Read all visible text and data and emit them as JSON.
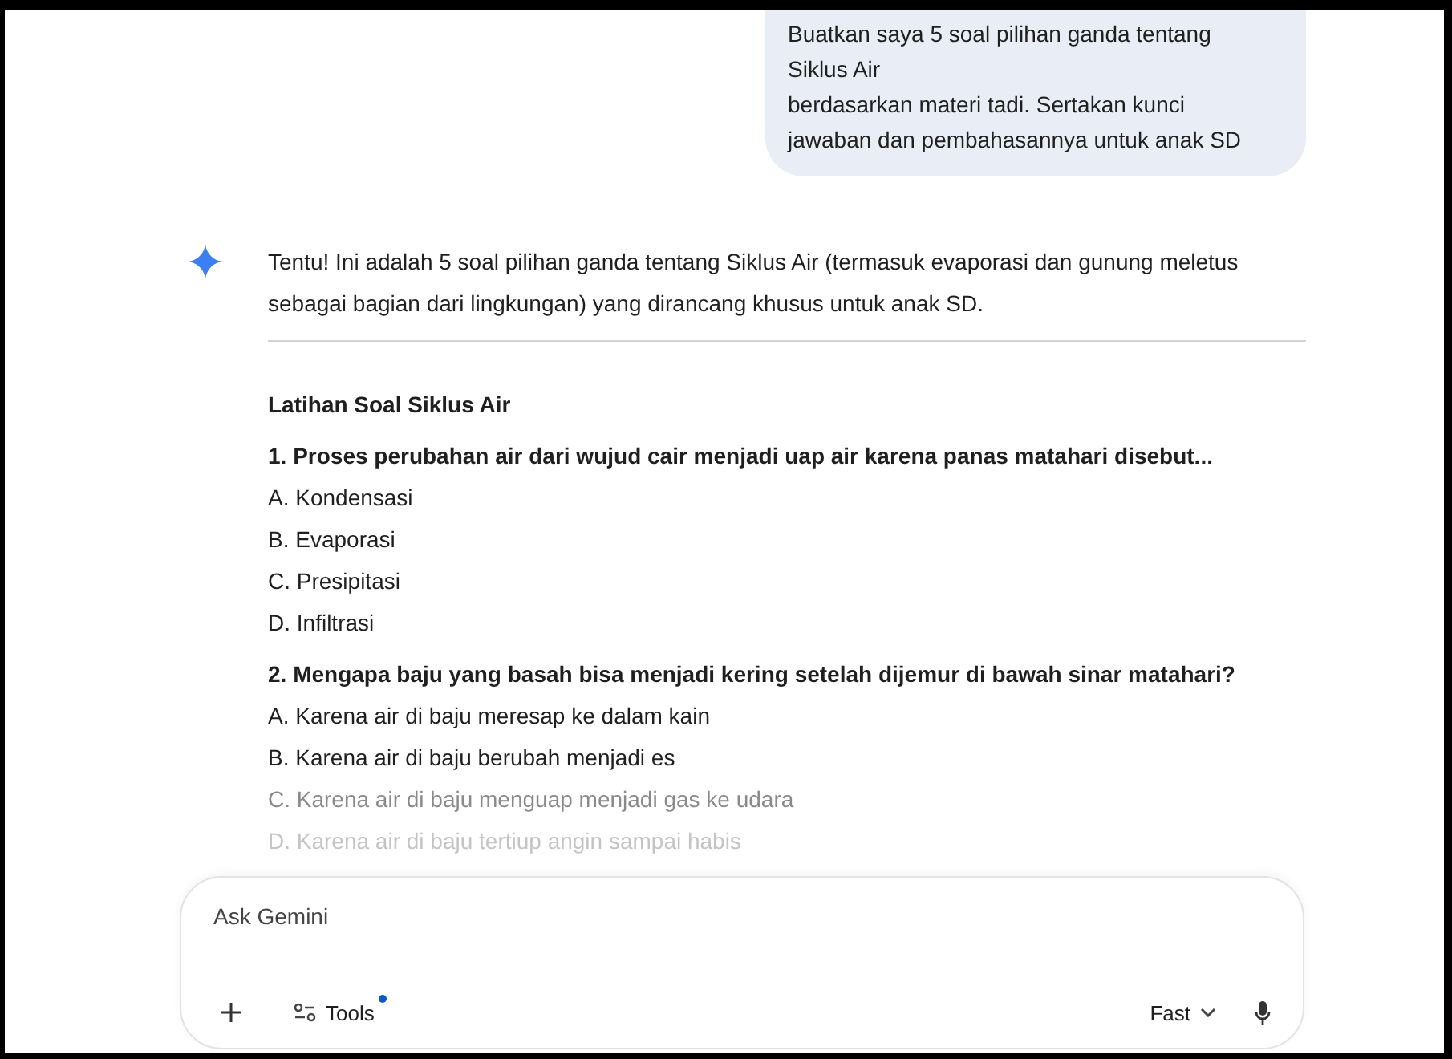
{
  "user_message": {
    "lines": [
      "Buatkan saya 5 soal pilihan ganda tentang Siklus Air",
      "berdasarkan materi tadi. Sertakan kunci",
      "jawaban dan pembahasannya untuk anak SD"
    ]
  },
  "response": {
    "intro": "Tentu! Ini adalah 5 soal pilihan ganda tentang Siklus Air (termasuk evaporasi dan gunung meletus sebagai bagian dari lingkungan) yang dirancang khusus untuk anak SD.",
    "heading": "Latihan Soal Siklus Air",
    "questions": [
      {
        "question": "1. Proses perubahan air dari wujud cair menjadi uap air karena panas matahari disebut...",
        "options": [
          "A. Kondensasi",
          "B. Evaporasi",
          "C. Presipitasi",
          "D. Infiltrasi"
        ]
      },
      {
        "question": "2. Mengapa baju yang basah bisa menjadi kering setelah dijemur di bawah sinar matahari?",
        "options": [
          "A. Karena air di baju meresap ke dalam kain",
          "B. Karena air di baju berubah menjadi es",
          "C. Karena air di baju menguap menjadi gas ke udara",
          "D. Karena air di baju tertiup angin sampai habis"
        ]
      }
    ]
  },
  "input": {
    "placeholder": "Ask Gemini",
    "tools_label": "Tools",
    "tools_notification": true,
    "mode_label": "Fast"
  }
}
